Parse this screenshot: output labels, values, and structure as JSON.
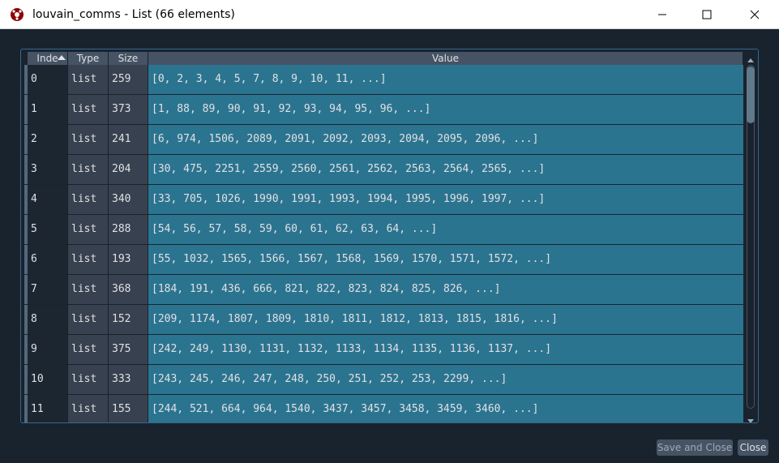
{
  "window": {
    "title": "louvain_comms - List (66 elements)",
    "icon": "spyder-app-icon",
    "controls": [
      "minimize-icon",
      "maximize-icon",
      "close-icon"
    ]
  },
  "table": {
    "headers": {
      "index": "Inde",
      "type": "Type",
      "size": "Size",
      "value": "Value"
    },
    "sort": {
      "column": "index",
      "direction": "ascending"
    },
    "rows": [
      {
        "index": "0",
        "type": "list",
        "size": "259",
        "value": "[0, 2, 3, 4, 5, 7, 8, 9, 10, 11, ...]"
      },
      {
        "index": "1",
        "type": "list",
        "size": "373",
        "value": "[1, 88, 89, 90, 91, 92, 93, 94, 95, 96, ...]"
      },
      {
        "index": "2",
        "type": "list",
        "size": "241",
        "value": "[6, 974, 1506, 2089, 2091, 2092, 2093, 2094, 2095, 2096, ...]"
      },
      {
        "index": "3",
        "type": "list",
        "size": "204",
        "value": "[30, 475, 2251, 2559, 2560, 2561, 2562, 2563, 2564, 2565, ...]"
      },
      {
        "index": "4",
        "type": "list",
        "size": "340",
        "value": "[33, 705, 1026, 1990, 1991, 1993, 1994, 1995, 1996, 1997, ...]"
      },
      {
        "index": "5",
        "type": "list",
        "size": "288",
        "value": "[54, 56, 57, 58, 59, 60, 61, 62, 63, 64, ...]"
      },
      {
        "index": "6",
        "type": "list",
        "size": "193",
        "value": "[55, 1032, 1565, 1566, 1567, 1568, 1569, 1570, 1571, 1572, ...]"
      },
      {
        "index": "7",
        "type": "list",
        "size": "368",
        "value": "[184, 191, 436, 666, 821, 822, 823, 824, 825, 826, ...]"
      },
      {
        "index": "8",
        "type": "list",
        "size": "152",
        "value": "[209, 1174, 1807, 1809, 1810, 1811, 1812, 1813, 1815, 1816, ...]"
      },
      {
        "index": "9",
        "type": "list",
        "size": "375",
        "value": "[242, 249, 1130, 1131, 1132, 1133, 1134, 1135, 1136, 1137, ...]"
      },
      {
        "index": "10",
        "type": "list",
        "size": "333",
        "value": "[243, 245, 246, 247, 248, 250, 251, 252, 253, 2299, ...]"
      },
      {
        "index": "11",
        "type": "list",
        "size": "155",
        "value": "[244, 521, 664, 964, 1540, 3437, 3457, 3458, 3459, 3460, ...]"
      }
    ]
  },
  "buttons": {
    "save_close": "Save and Close",
    "close": "Close"
  },
  "colors": {
    "background": "#19232d",
    "value_cell": "#2b7490",
    "header": "#455364"
  }
}
